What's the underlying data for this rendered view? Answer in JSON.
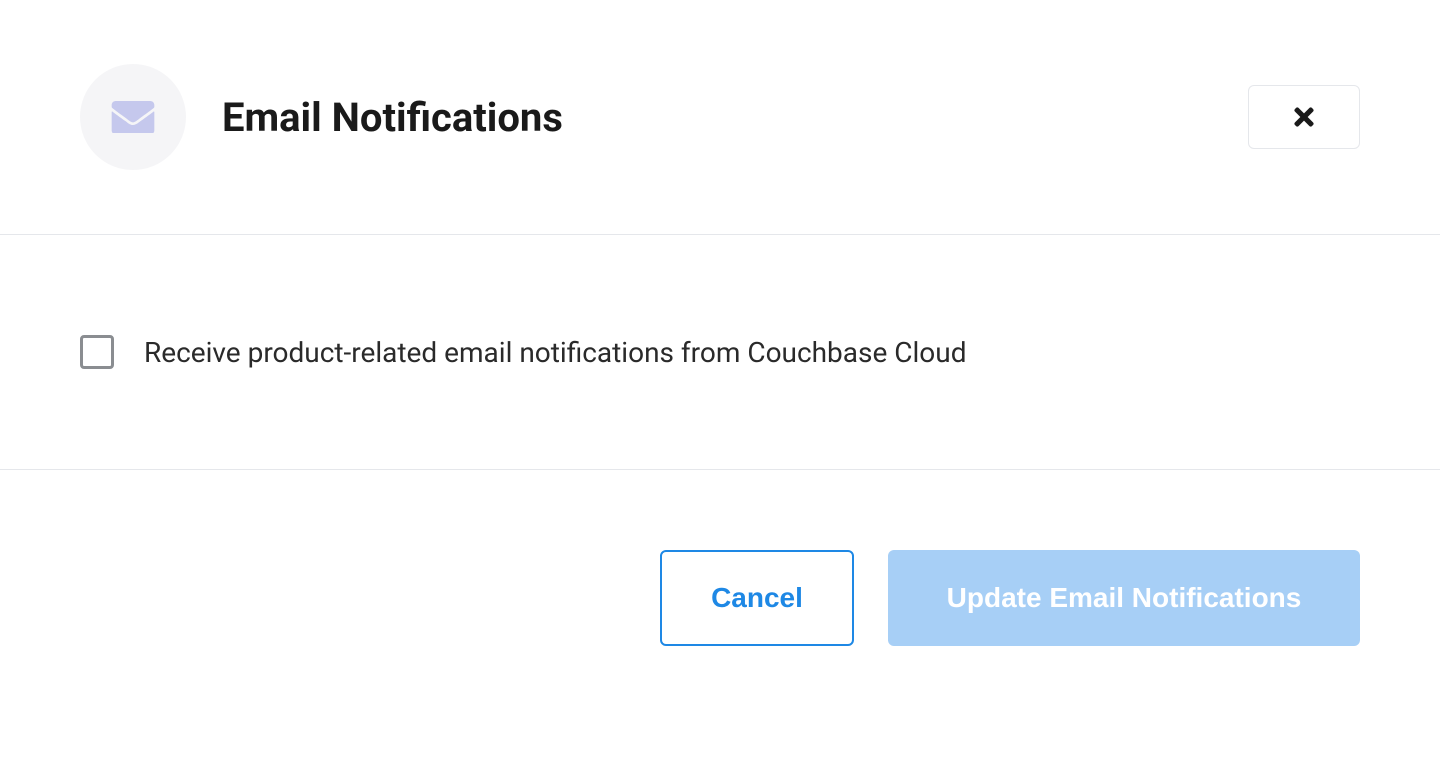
{
  "header": {
    "title": "Email Notifications",
    "icon": "envelope-icon",
    "close_icon": "close-icon"
  },
  "body": {
    "checkbox_label": "Receive product-related email notifications from Couchbase Cloud",
    "checkbox_checked": false
  },
  "footer": {
    "cancel_label": "Cancel",
    "submit_label": "Update Email Notifications"
  },
  "colors": {
    "icon_fill": "#c5c8ed",
    "primary_button_bg": "#a7cff6",
    "cancel_button_border": "#1e88e5"
  }
}
